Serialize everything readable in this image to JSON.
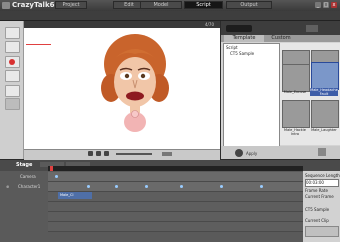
{
  "window": {
    "title": "CrazyTalk6"
  },
  "tabs": [
    {
      "label": "Project"
    },
    {
      "label": "Edit"
    },
    {
      "label": "Model"
    },
    {
      "label": "Script"
    },
    {
      "label": "Output"
    }
  ],
  "viewport": {
    "frame_readout": "4/70"
  },
  "right_panel": {
    "subtabs": [
      "Template",
      "Custom"
    ],
    "tree": [
      "Script",
      "CT5 Sample"
    ],
    "thumbs": [
      {
        "label": ""
      },
      {
        "label": ""
      },
      {
        "label": "Male_Excuse"
      },
      {
        "label": "Male_Headache Fault"
      },
      {
        "label": ""
      },
      {
        "label": ""
      },
      {
        "label": "Male_Hackie Intro"
      },
      {
        "label": "Male_Laughter"
      }
    ],
    "footer": "Apply"
  },
  "timeline": {
    "title": "Stage",
    "tracks": [
      "Camera",
      "Character1"
    ],
    "clip_label": "Male_Cl",
    "side_items": [
      "Sequence Length",
      "00:03:00",
      "Frame Rate",
      "Current Frame",
      "",
      "CT5 Sample",
      "Current Clip"
    ]
  },
  "colors": {
    "accent": "#7b97c9",
    "record": "#d83030"
  }
}
